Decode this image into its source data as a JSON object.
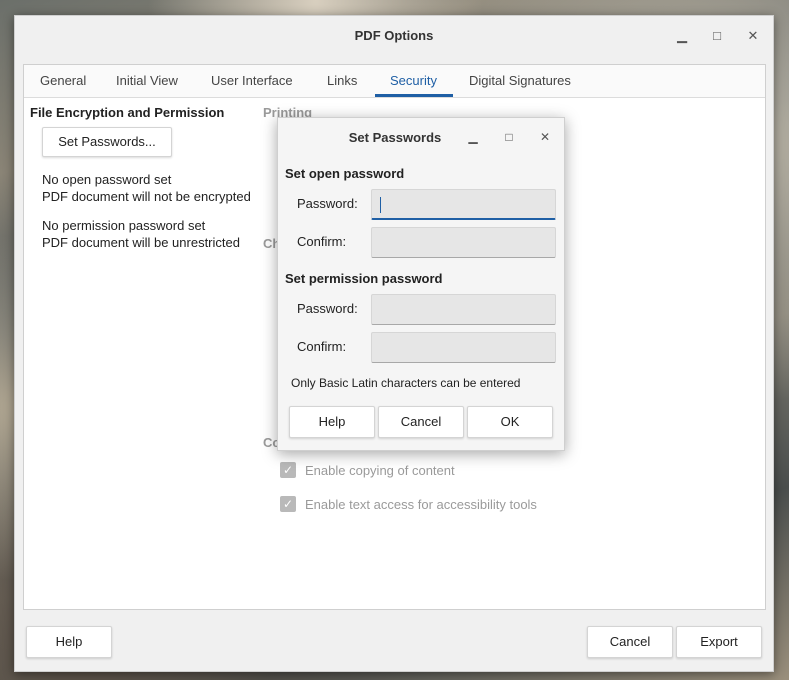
{
  "window": {
    "title": "PDF Options",
    "minimize_icon": "minimize-icon",
    "maximize_icon": "maximize-icon",
    "close_icon": "close-icon"
  },
  "tabs": [
    {
      "label": "General",
      "active": false
    },
    {
      "label": "Initial View",
      "active": false
    },
    {
      "label": "User Interface",
      "active": false
    },
    {
      "label": "Links",
      "active": false
    },
    {
      "label": "Security",
      "active": true
    },
    {
      "label": "Digital Signatures",
      "active": false
    }
  ],
  "security": {
    "section_title": "File Encryption and Permission",
    "set_passwords_button": "Set Passwords...",
    "open_status_line1": "No open password set",
    "open_status_line2": "PDF document will not be encrypted",
    "perm_status_line1": "No permission password set",
    "perm_status_line2": "PDF document will be unrestricted",
    "printing_heading": "Printing",
    "changes_heading_partial": "Ch",
    "content_heading_partial": "Co",
    "checkboxes": [
      {
        "label": "Enable copying of content",
        "checked": true
      },
      {
        "label": "Enable text access for accessibility tools",
        "checked": true
      }
    ]
  },
  "dialog": {
    "title": "Set Passwords",
    "open_section": "Set open password",
    "open_password_label": "Password:",
    "open_confirm_label": "Confirm:",
    "open_password_value": "",
    "open_confirm_value": "",
    "perm_section": "Set permission password",
    "perm_password_label": "Password:",
    "perm_confirm_label": "Confirm:",
    "perm_password_value": "",
    "perm_confirm_value": "",
    "note": "Only Basic Latin characters can be entered",
    "help_button": "Help",
    "cancel_button": "Cancel",
    "ok_button": "OK"
  },
  "footer": {
    "help_button": "Help",
    "cancel_button": "Cancel",
    "export_button": "Export"
  },
  "colors": {
    "accent": "#1f5fa5",
    "window_bg": "#f0f0f0",
    "disabled_text": "#9a9a9a"
  }
}
